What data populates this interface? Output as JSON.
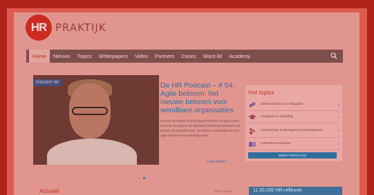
{
  "logo": {
    "mark": "HR",
    "word": "PRAKTIJK"
  },
  "nav": {
    "items": [
      "Home",
      "Nieuws",
      "Topics",
      "Whitepapers",
      "Video",
      "Partners",
      "Cases",
      "Word lid",
      "Academy"
    ]
  },
  "hero": {
    "badge": "PODCAST HR",
    "title": "De HR Podcast – # 54: Agile belonen: het nieuwe belonen voor wendbare organisaties",
    "body": "Lennart de Winter is beloningsconsultant en legt in deze podcast uit waarom de klassieke beloningssystemen niet passen bij veranderende, wendbare organisaties en hoe agile belonen een oplossing biedt.",
    "read_more": "Lees verder ›"
  },
  "hot_topics": {
    "title": "Hot topics",
    "items": [
      {
        "label": "Ziekteverzuim & re-integratie",
        "icon": "bandage-icon"
      },
      {
        "label": "Loopbaan & opleiding",
        "icon": "graduation-cap-icon"
      },
      {
        "label": "Leiderschap & Management Development",
        "icon": "leadership-icon"
      },
      {
        "label": "Arbeidsvoorwaarden",
        "icon": "book-icon"
      }
    ],
    "more_button": "MEER TOPICS (22)"
  },
  "actueel": {
    "title": "Actueel",
    "more": "Meer nieuws"
  },
  "promo": {
    "text": "11.05.000 HR-reflexxie"
  },
  "colors": {
    "brand_red": "#cc2b22",
    "link_blue": "#2f6e9d"
  }
}
